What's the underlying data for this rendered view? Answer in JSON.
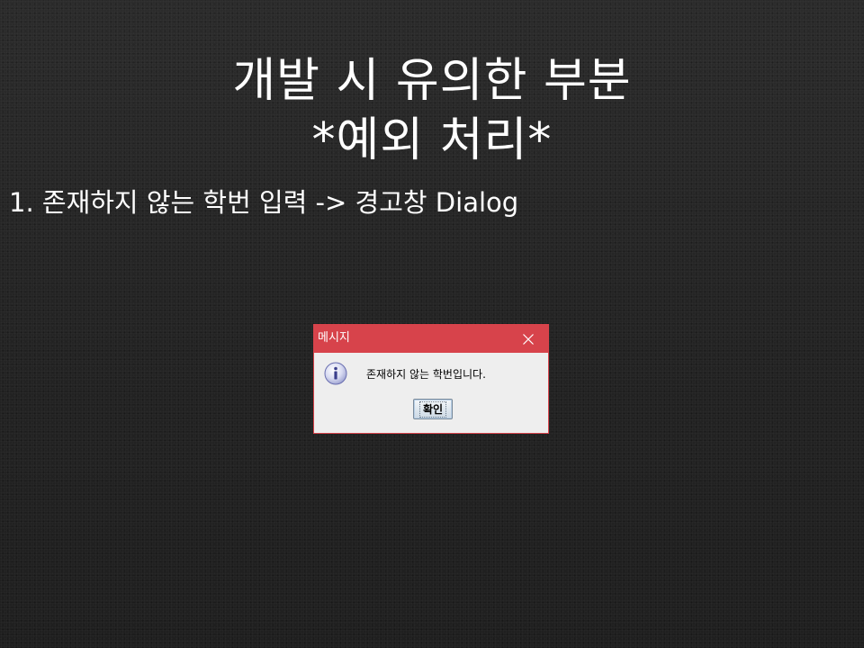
{
  "slide": {
    "title_line1": "개발 시 유의한 부분",
    "title_line2": "*예외 처리*",
    "bullet": "1. 존재하지 않는 학번 입력 -> 경고창 Dialog"
  },
  "dialog": {
    "title": "메시지",
    "message": "존재하지 않는 학번입니다.",
    "ok_label": "확인",
    "icons": {
      "close": "close-icon",
      "message_type": "info-icon"
    },
    "colors": {
      "titlebar": "#d7434b",
      "body": "#eeeeee"
    }
  }
}
